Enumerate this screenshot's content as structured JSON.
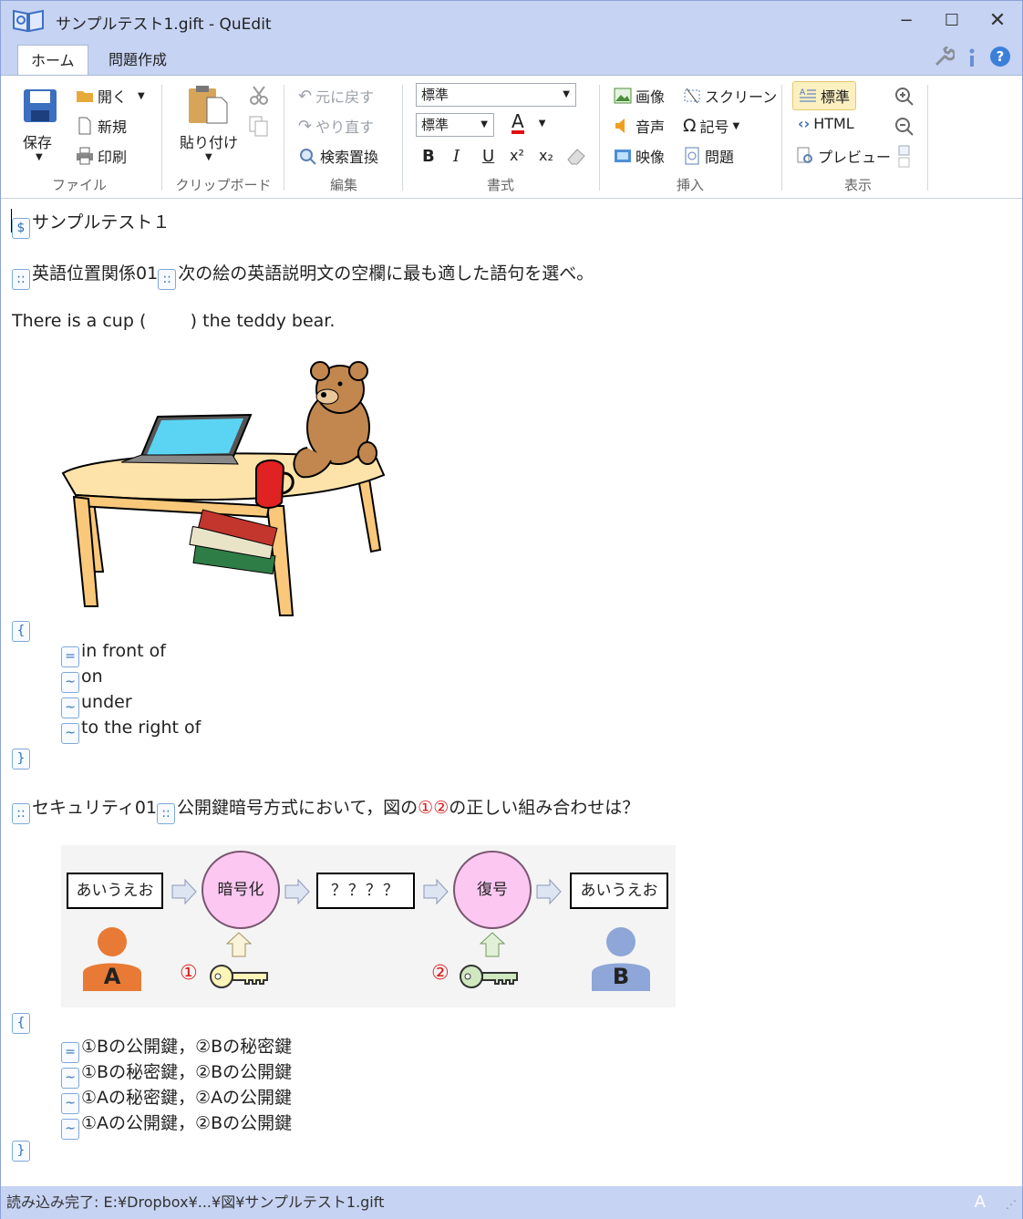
{
  "window": {
    "title": "サンプルテスト1.gift - QuEdit",
    "min": "−",
    "max": "☐",
    "close": "✕"
  },
  "tabs": [
    {
      "label": "ホーム"
    },
    {
      "label": "問題作成"
    }
  ],
  "ribbon": {
    "file": {
      "label": "ファイル",
      "save": "保存",
      "open": "開く",
      "new": "新規",
      "print": "印刷"
    },
    "clipboard": {
      "label": "クリップボード",
      "paste": "貼り付け"
    },
    "edit": {
      "label": "編集",
      "undo": "元に戻す",
      "redo": "やり直す",
      "find": "検索置換"
    },
    "format": {
      "label": "書式",
      "style": "標準",
      "size": "標準",
      "bold": "B",
      "italic": "I",
      "underline": "U",
      "sup": "x²",
      "sub": "x₂",
      "color_letter": "A"
    },
    "insert": {
      "label": "挿入",
      "image": "画像",
      "screen": "スクリーン",
      "audio": "音声",
      "symbol": "記号",
      "video": "映像",
      "question": "問題"
    },
    "view": {
      "label": "表示",
      "standard": "標準",
      "html": "HTML",
      "preview": "プレビュー"
    }
  },
  "doc": {
    "title": "サンプルテスト１",
    "q1": {
      "name": "英語位置関係01",
      "text": "次の絵の英語説明文の空欄に最も適した語句を選べ。",
      "sentence": "There is a cup (        ) the teddy bear.",
      "choices": [
        "in front of",
        "on",
        "under",
        "to the right of"
      ],
      "marks": [
        "=",
        "~",
        "~",
        "~"
      ]
    },
    "q2": {
      "name": "セキュリティ01",
      "text_a": "公開鍵暗号方式において，図の",
      "text_b": "①②",
      "text_c": "の正しい組み合わせは？",
      "choices": [
        "①Bの公開鍵，②Bの秘密鍵",
        "①Bの秘密鍵，②Bの公開鍵",
        "①Aの秘密鍵，②Aの公開鍵",
        "①Aの公開鍵，②Bの公開鍵"
      ],
      "marks": [
        "=",
        "~",
        "~",
        "~"
      ],
      "diagram": {
        "plain1": "あいうえお",
        "encrypt": "暗号化",
        "cipher": "？？？？",
        "decrypt": "復号",
        "plain2": "あいうえお",
        "personA": "A",
        "personB": "B",
        "key1": "①",
        "key2": "②"
      }
    },
    "open_brace": "{",
    "close_brace": "}",
    "dollar": "$",
    "colons": "::"
  },
  "status": {
    "text": "読み込み完了: E:¥Dropbox¥...¥図¥サンプルテスト1.gift",
    "ime": "A"
  }
}
